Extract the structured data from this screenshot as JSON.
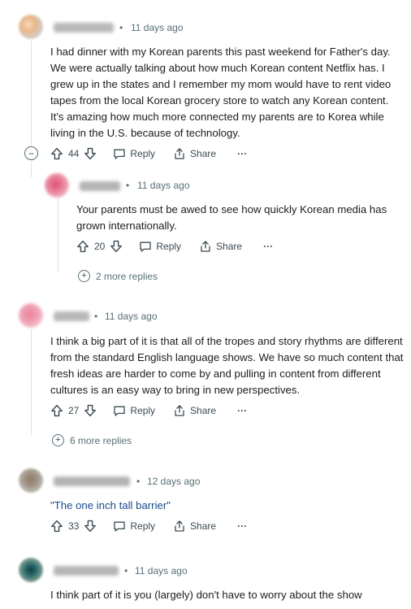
{
  "colors": {
    "meta": "#576f76",
    "link": "#1a4b8c",
    "thread_line": "#dfe3e5"
  },
  "actions": {
    "reply_label": "Reply",
    "share_label": "Share",
    "more_label": "···"
  },
  "comments": [
    {
      "time": "11 days ago",
      "body": "I had dinner with my Korean parents this past weekend for Father's day. We were actually talking about how much Korean content Netflix has. I grew up in the states and I remember my mom would have to rent video tapes from the local Korean grocery store to watch any Korean content. It's amazing how much more connected my parents are to Korea while living in the U.S. because of technology.",
      "votes": "44"
    },
    {
      "time": "11 days ago",
      "body": "Your parents must be awed to see how quickly Korean media has grown internationally.",
      "votes": "20",
      "more_replies": "2 more replies"
    },
    {
      "time": "11 days ago",
      "body": "I think a big part of it is that all of the tropes and story rhythms are different from the standard English language shows. We have so much content that fresh ideas are harder to come by and pulling in content from different cultures is an easy way to bring in new perspectives.",
      "votes": "27",
      "more_replies": "6 more replies"
    },
    {
      "time": "12 days ago",
      "body": "\"The one inch tall barrier\"",
      "votes": "33"
    },
    {
      "time": "11 days ago",
      "body": "I think part of it is you (largely) don't have to worry about the show"
    }
  ]
}
